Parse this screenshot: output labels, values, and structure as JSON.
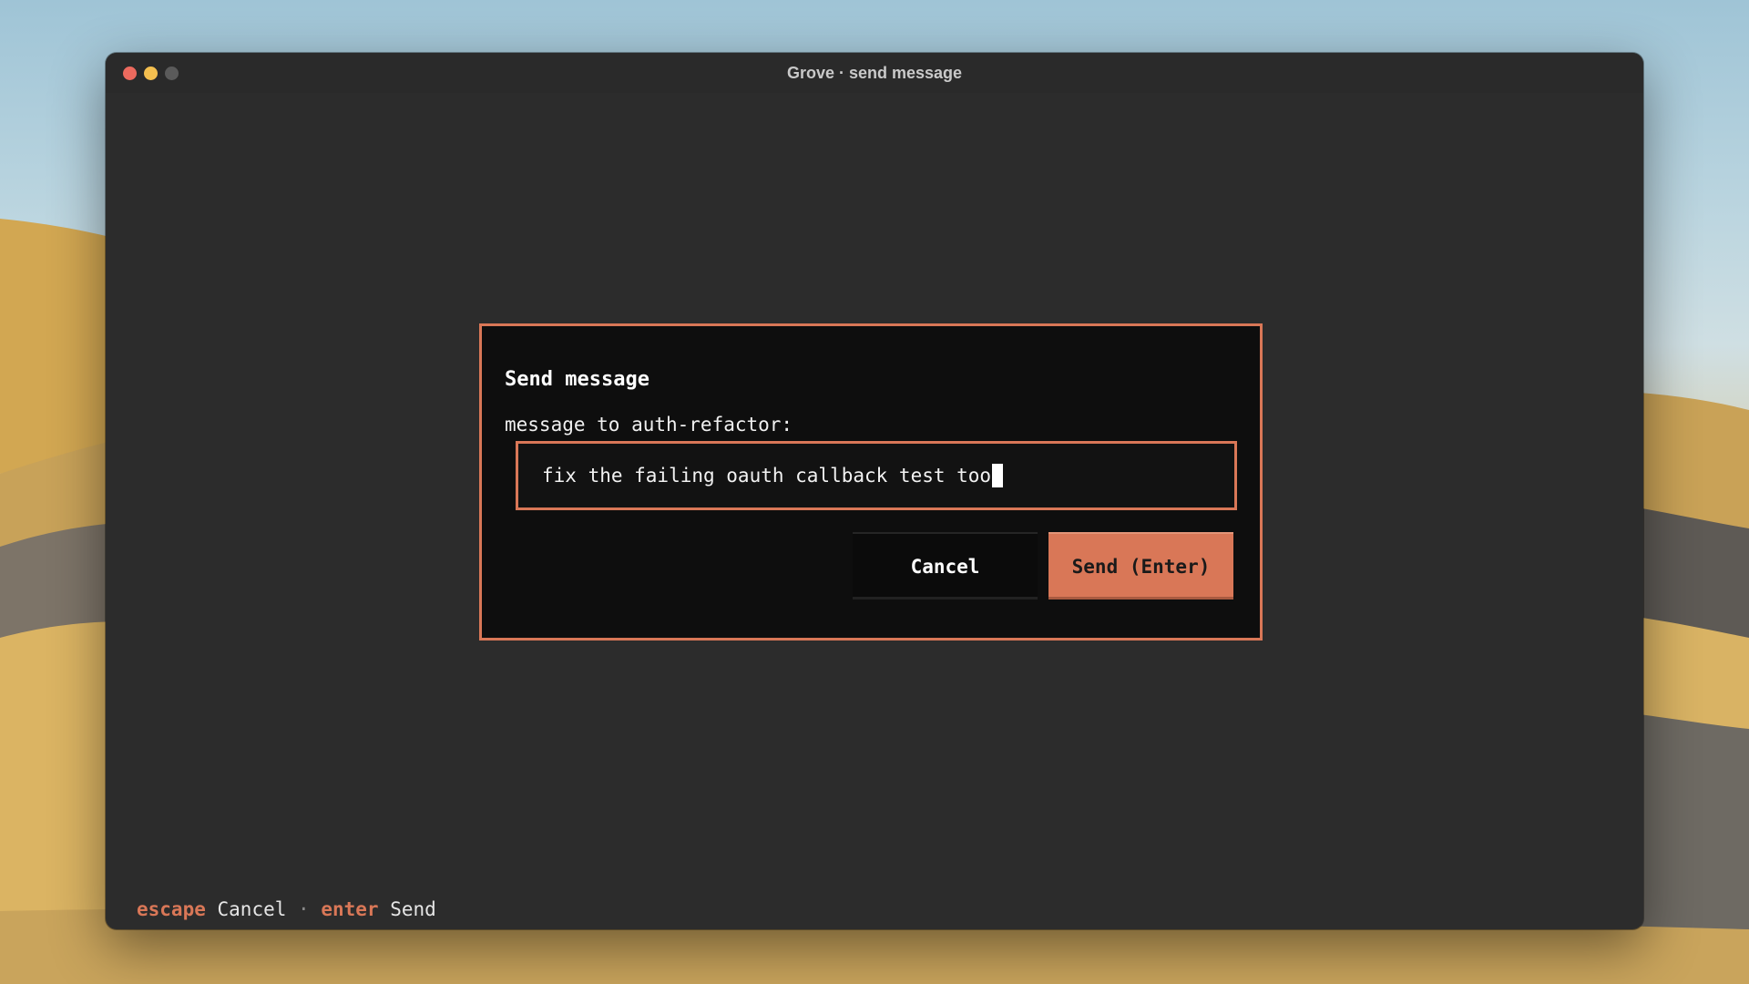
{
  "window": {
    "title": "Grove · send message"
  },
  "dialog": {
    "title": "Send message",
    "prompt": "message to auth-refactor:",
    "input_value": "fix the failing oauth callback test too",
    "cancel_label": "Cancel",
    "send_label": "Send (Enter)"
  },
  "footer": {
    "bindings": [
      {
        "key": "escape",
        "action": "Cancel"
      },
      {
        "key": "enter",
        "action": "Send"
      }
    ],
    "separator": "·"
  },
  "colors": {
    "accent": "#d97757",
    "dialog_bg": "#0e0e0e",
    "window_bg": "#2c2c2c"
  }
}
